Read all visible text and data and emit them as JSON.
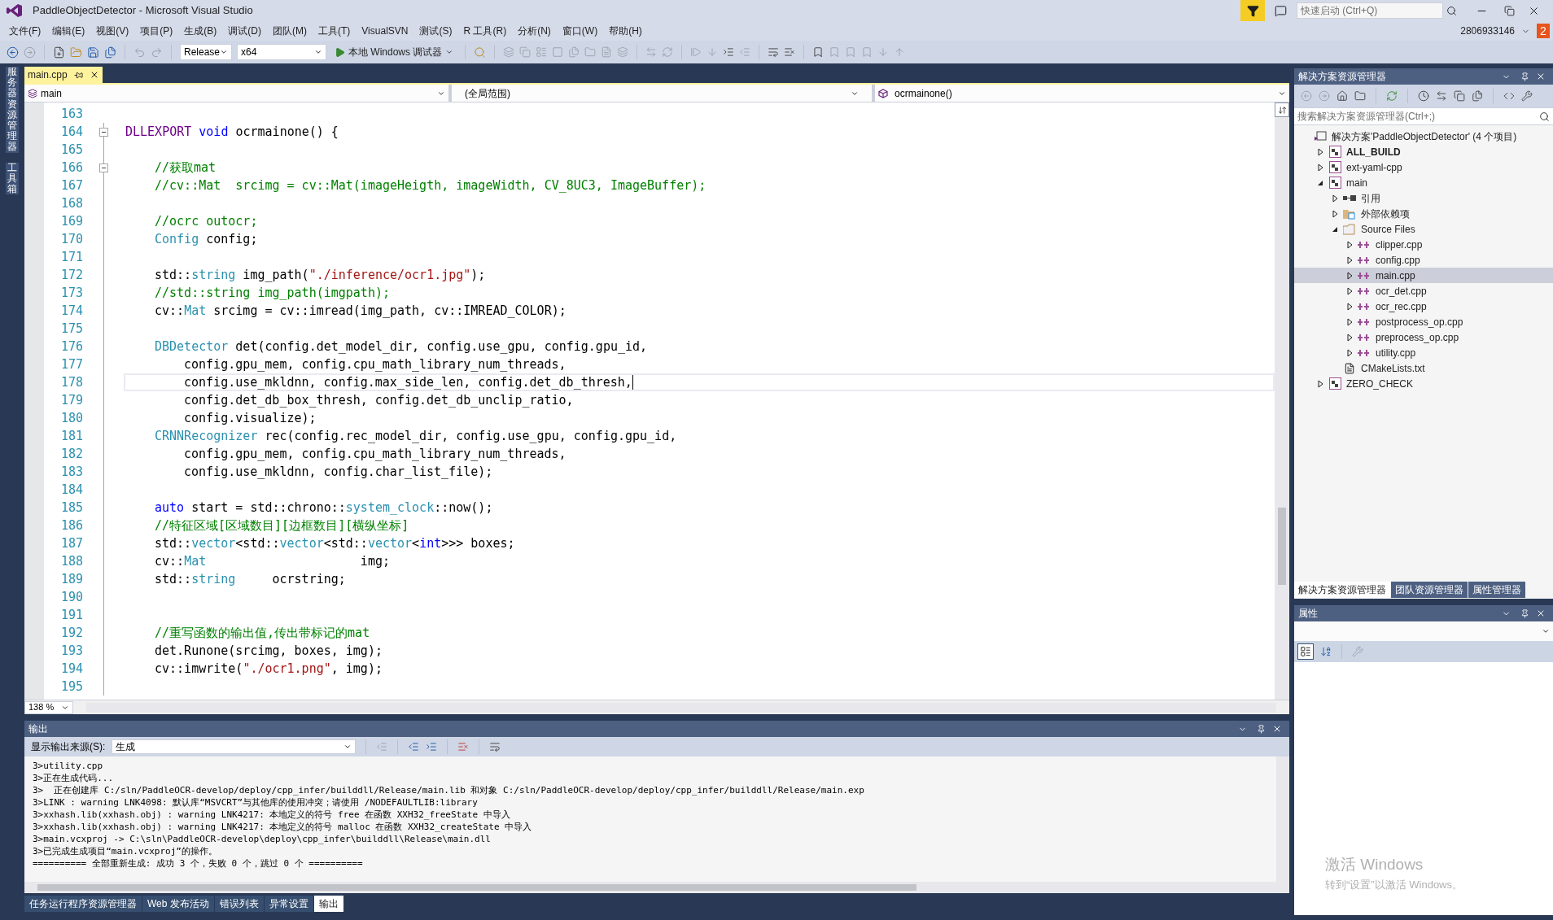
{
  "window": {
    "title": "PaddleObjectDetector - Microsoft Visual Studio",
    "quick_launch": {
      "placeholder": "快速启动 (Ctrl+Q)"
    },
    "account": "2806933146",
    "notifications": "2"
  },
  "menu": [
    "文件(F)",
    "编辑(E)",
    "视图(V)",
    "项目(P)",
    "生成(B)",
    "调试(D)",
    "团队(M)",
    "工具(T)",
    "VisualSVN",
    "测试(S)",
    "R 工具(R)",
    "分析(N)",
    "窗口(W)",
    "帮助(H)"
  ],
  "toolbar": {
    "configuration": "Release",
    "platform": "x64",
    "start_button": "本地 Windows 调试器"
  },
  "left_tabs": [
    "服务器资源管理器",
    "工具箱"
  ],
  "editor": {
    "tabs": [
      {
        "label": "main.cpp",
        "selected": true
      }
    ],
    "nav": {
      "project": "main",
      "scope": "(全局范围)",
      "member": "ocrmainone()"
    },
    "zoom": "138 %",
    "lines": [
      {
        "n": "163",
        "fold": false,
        "current": false
      },
      {
        "n": "164",
        "fold": true,
        "current": false,
        "kind": "top",
        "tokens": [
          {
            "kind": "macro",
            "text": "DLLEXPORT "
          },
          {
            "kind": "keyword",
            "text": "void"
          },
          {
            "kind": "plain",
            "text": " ocrmainone() {"
          }
        ]
      },
      {
        "n": "165",
        "fold": false,
        "current": false
      },
      {
        "n": "166",
        "fold": true,
        "current": false,
        "kind": "body",
        "tokens": [
          {
            "kind": "comment",
            "text": "//获取mat"
          }
        ]
      },
      {
        "n": "167",
        "fold": false,
        "current": false,
        "kind": "body",
        "tokens": [
          {
            "kind": "comment",
            "text": "//cv::Mat  srcimg = cv::Mat(imageHeigth, imageWidth, CV_8UC3, ImageBuffer);"
          }
        ]
      },
      {
        "n": "168",
        "fold": false,
        "current": false
      },
      {
        "n": "169",
        "fold": false,
        "current": false,
        "kind": "body",
        "tokens": [
          {
            "kind": "comment",
            "text": "//ocrc outocr;"
          }
        ]
      },
      {
        "n": "170",
        "fold": false,
        "current": false,
        "kind": "body",
        "tokens": [
          {
            "kind": "type",
            "text": "Config"
          },
          {
            "kind": "plain",
            "text": " config;"
          }
        ]
      },
      {
        "n": "171",
        "fold": false,
        "current": false
      },
      {
        "n": "172",
        "fold": false,
        "current": false,
        "kind": "body",
        "tokens": [
          {
            "kind": "plain",
            "text": "std::"
          },
          {
            "kind": "type",
            "text": "string"
          },
          {
            "kind": "plain",
            "text": " img_path("
          },
          {
            "kind": "string",
            "text": "\"./inference/ocr1.jpg\""
          },
          {
            "kind": "plain",
            "text": ");"
          }
        ]
      },
      {
        "n": "173",
        "fold": false,
        "current": false,
        "kind": "body",
        "tokens": [
          {
            "kind": "comment",
            "text": "//std::string img_path(imgpath);"
          }
        ]
      },
      {
        "n": "174",
        "fold": false,
        "current": false,
        "kind": "body",
        "tokens": [
          {
            "kind": "plain",
            "text": "cv::"
          },
          {
            "kind": "type",
            "text": "Mat"
          },
          {
            "kind": "plain",
            "text": " srcimg = cv::imread(img_path, cv::IMREAD_COLOR);"
          }
        ]
      },
      {
        "n": "175",
        "fold": false,
        "current": false
      },
      {
        "n": "176",
        "fold": false,
        "current": false,
        "kind": "body",
        "tokens": [
          {
            "kind": "type",
            "text": "DBDetector"
          },
          {
            "kind": "plain",
            "text": " det(config.det_model_dir, config.use_gpu, config.gpu_id,"
          }
        ]
      },
      {
        "n": "177",
        "fold": false,
        "current": false,
        "kind": "continuation",
        "tokens": [
          {
            "kind": "plain",
            "text": "config.gpu_mem, config.cpu_math_library_num_threads,"
          }
        ]
      },
      {
        "n": "178",
        "fold": false,
        "current": true,
        "kind": "continuation",
        "tokens": [
          {
            "kind": "plain",
            "text": "config.use_mkldnn, config.max_side_len, config.det_db_thresh,"
          }
        ]
      },
      {
        "n": "179",
        "fold": false,
        "current": false,
        "kind": "continuation",
        "tokens": [
          {
            "kind": "plain",
            "text": "config.det_db_box_thresh, config.det_db_unclip_ratio,"
          }
        ]
      },
      {
        "n": "180",
        "fold": false,
        "current": false,
        "kind": "continuation",
        "tokens": [
          {
            "kind": "plain",
            "text": "config.visualize);"
          }
        ]
      },
      {
        "n": "181",
        "fold": false,
        "current": false,
        "kind": "body",
        "tokens": [
          {
            "kind": "type",
            "text": "CRNNRecognizer"
          },
          {
            "kind": "plain",
            "text": " rec(config.rec_model_dir, config.use_gpu, config.gpu_id,"
          }
        ]
      },
      {
        "n": "182",
        "fold": false,
        "current": false,
        "kind": "continuation",
        "tokens": [
          {
            "kind": "plain",
            "text": "config.gpu_mem, config.cpu_math_library_num_threads,"
          }
        ]
      },
      {
        "n": "183",
        "fold": false,
        "current": false,
        "kind": "continuation",
        "tokens": [
          {
            "kind": "plain",
            "text": "config.use_mkldnn, config.char_list_file);"
          }
        ]
      },
      {
        "n": "184",
        "fold": false,
        "current": false
      },
      {
        "n": "185",
        "fold": false,
        "current": false,
        "kind": "body",
        "tokens": [
          {
            "kind": "keyword",
            "text": "auto"
          },
          {
            "kind": "plain",
            "text": " start = std::chrono::"
          },
          {
            "kind": "type",
            "text": "system_clock"
          },
          {
            "kind": "plain",
            "text": "::now();"
          }
        ]
      },
      {
        "n": "186",
        "fold": false,
        "current": false,
        "kind": "body",
        "tokens": [
          {
            "kind": "comment",
            "text": "//特征区域[区域数目][边框数目][横纵坐标]"
          }
        ]
      },
      {
        "n": "187",
        "fold": false,
        "current": false,
        "kind": "body",
        "tokens": [
          {
            "kind": "plain",
            "text": "std::"
          },
          {
            "kind": "type",
            "text": "vector"
          },
          {
            "kind": "plain",
            "text": "<std::"
          },
          {
            "kind": "type",
            "text": "vector"
          },
          {
            "kind": "plain",
            "text": "<std::"
          },
          {
            "kind": "type",
            "text": "vector"
          },
          {
            "kind": "plain",
            "text": "<"
          },
          {
            "kind": "keyword",
            "text": "int"
          },
          {
            "kind": "plain",
            "text": ">>> boxes;"
          }
        ]
      },
      {
        "n": "188",
        "fold": false,
        "current": false,
        "kind": "body",
        "tokens": [
          {
            "kind": "plain",
            "text": "cv::"
          },
          {
            "kind": "type",
            "text": "Mat"
          },
          {
            "kind": "plain",
            "text": "                     img;"
          }
        ]
      },
      {
        "n": "189",
        "fold": false,
        "current": false,
        "kind": "body",
        "tokens": [
          {
            "kind": "plain",
            "text": "std::"
          },
          {
            "kind": "type",
            "text": "string"
          },
          {
            "kind": "plain",
            "text": "     ocrstring;"
          }
        ]
      },
      {
        "n": "190",
        "fold": false,
        "current": false
      },
      {
        "n": "191",
        "fold": false,
        "current": false
      },
      {
        "n": "192",
        "fold": false,
        "current": false,
        "kind": "body",
        "tokens": [
          {
            "kind": "comment",
            "text": "//重写函数的输出值,传出带标记的mat"
          }
        ]
      },
      {
        "n": "193",
        "fold": false,
        "current": false,
        "kind": "body",
        "tokens": [
          {
            "kind": "plain",
            "text": "det.Runone(srcimg, boxes, img);"
          }
        ]
      },
      {
        "n": "194",
        "fold": false,
        "current": false,
        "kind": "body",
        "tokens": [
          {
            "kind": "plain",
            "text": "cv::imwrite("
          },
          {
            "kind": "string",
            "text": "\"./ocr1.png\""
          },
          {
            "kind": "plain",
            "text": ", img);"
          }
        ]
      },
      {
        "n": "195",
        "fold": false,
        "current": false
      }
    ]
  },
  "solution_explorer": {
    "title": "解决方案资源管理器",
    "search": {
      "placeholder": "搜索解决方案资源管理器(Ctrl+;)"
    },
    "tree": [
      {
        "label": "解决方案'PaddleObjectDetector' (4 个项目)",
        "kind": "solution",
        "selected": false,
        "children": [
          {
            "label": "ALL_BUILD",
            "kind": "project",
            "startup": true,
            "expanded": false,
            "selected": false
          },
          {
            "label": "ext-yaml-cpp",
            "kind": "project",
            "startup": false,
            "expanded": false,
            "selected": false
          },
          {
            "label": "main",
            "kind": "project",
            "startup": false,
            "expanded": true,
            "selected": false,
            "children": [
              {
                "label": "引用",
                "kind": "references",
                "expanded": false,
                "selected": false
              },
              {
                "label": "外部依赖项",
                "kind": "dependencies",
                "expanded": false,
                "selected": false
              },
              {
                "label": "Source Files",
                "kind": "folder",
                "expanded": true,
                "selected": false,
                "children": [
                  {
                    "label": "clipper.cpp",
                    "kind": "cpp",
                    "expanded": false,
                    "selected": false
                  },
                  {
                    "label": "config.cpp",
                    "kind": "cpp",
                    "expanded": false,
                    "selected": false
                  },
                  {
                    "label": "main.cpp",
                    "kind": "cpp",
                    "expanded": false,
                    "selected": true
                  },
                  {
                    "label": "ocr_det.cpp",
                    "kind": "cpp",
                    "expanded": false,
                    "selected": false
                  },
                  {
                    "label": "ocr_rec.cpp",
                    "kind": "cpp",
                    "expanded": false,
                    "selected": false
                  },
                  {
                    "label": "postprocess_op.cpp",
                    "kind": "cpp",
                    "expanded": false,
                    "selected": false
                  },
                  {
                    "label": "preprocess_op.cpp",
                    "kind": "cpp",
                    "expanded": false,
                    "selected": false
                  },
                  {
                    "label": "utility.cpp",
                    "kind": "cpp",
                    "expanded": false,
                    "selected": false
                  }
                ]
              },
              {
                "label": "CMakeLists.txt",
                "kind": "text",
                "selected": false
              }
            ]
          },
          {
            "label": "ZERO_CHECK",
            "kind": "project",
            "startup": false,
            "expanded": false,
            "selected": false
          }
        ]
      }
    ]
  },
  "panel_tabs": [
    {
      "label": "解决方案资源管理器",
      "selected": true
    },
    {
      "label": "团队资源管理器",
      "selected": false
    },
    {
      "label": "属性管理器",
      "selected": false
    }
  ],
  "properties": {
    "title": "属性"
  },
  "output": {
    "title": "输出",
    "source_label": "显示输出来源(S):",
    "source": "生成",
    "lines": [
      "3>utility.cpp",
      "3>正在生成代码...",
      "3>  正在创建库 C:/sln/PaddleOCR-develop/deploy/cpp_infer/builddll/Release/main.lib 和对象 C:/sln/PaddleOCR-develop/deploy/cpp_infer/builddll/Release/main.exp",
      "3>LINK : warning LNK4098: 默认库“MSVCRT”与其他库的使用冲突；请使用 /NODEFAULTLIB:library",
      "3>xxhash.lib(xxhash.obj) : warning LNK4217: 本地定义的符号 free 在函数 XXH32_freeState 中导入",
      "3>xxhash.lib(xxhash.obj) : warning LNK4217: 本地定义的符号 malloc 在函数 XXH32_createState 中导入",
      "3>main.vcxproj -> C:\\sln\\PaddleOCR-develop\\deploy\\cpp_infer\\builddll\\Release\\main.dll",
      "3>已完成生成项目“main.vcxproj”的操作。",
      "========== 全部重新生成: 成功 3 个，失败 0 个，跳过 0 个 =========="
    ]
  },
  "bottom_tabs": [
    {
      "label": "任务运行程序资源管理器",
      "selected": false
    },
    {
      "label": "Web 发布活动",
      "selected": false
    },
    {
      "label": "错误列表",
      "selected": false
    },
    {
      "label": "异常设置",
      "selected": false
    },
    {
      "label": "输出",
      "selected": true
    }
  ],
  "activation_notice": {
    "title": "激活 Windows",
    "text": "转到“设置”以激活 Windows。"
  }
}
